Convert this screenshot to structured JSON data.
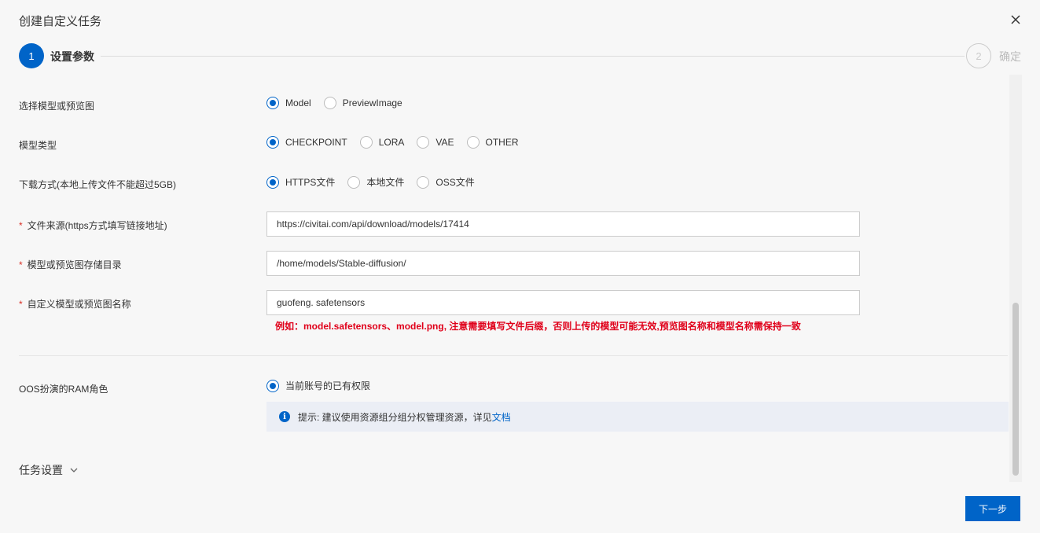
{
  "dialog": {
    "title": "创建自定义任务",
    "next_label": "下一步"
  },
  "steps": [
    {
      "number": "1",
      "label": "设置参数",
      "state": "active"
    },
    {
      "number": "2",
      "label": "确定",
      "state": "inactive"
    }
  ],
  "form": {
    "model_or_preview": {
      "label": "选择模型或预览图",
      "options": [
        "Model",
        "PreviewImage"
      ],
      "selected": "Model"
    },
    "model_type": {
      "label": "模型类型",
      "options": [
        "CHECKPOINT",
        "LORA",
        "VAE",
        "OTHER"
      ],
      "selected": "CHECKPOINT"
    },
    "download_method": {
      "label": "下载方式(本地上传文件不能超过5GB)",
      "options": [
        "HTTPS文件",
        "本地文件",
        "OSS文件"
      ],
      "selected": "HTTPS文件"
    },
    "file_source": {
      "required": "*",
      "label": "文件来源(https方式填写链接地址)",
      "value": "https://civitai.com/api/download/models/17414"
    },
    "storage_dir": {
      "required": "*",
      "label": "模型或预览图存储目录",
      "value": "/home/models/Stable-diffusion/"
    },
    "custom_name": {
      "required": "*",
      "label": "自定义模型或预览图名称",
      "value": "guofeng. safetensors",
      "hint": "例如：model.safetensors、model.png, 注意需要填写文件后缀，否则上传的模型可能无效,预览图名称和模型名称需保持一致"
    },
    "ram_role": {
      "label": "OOS扮演的RAM角色",
      "options": [
        "当前账号的已有权限"
      ],
      "selected": "当前账号的已有权限",
      "info_text": "提示: 建议使用资源组分组分权管理资源，详见",
      "info_link": "文档"
    }
  },
  "task_settings": {
    "label": "任务设置"
  },
  "colors": {
    "primary": "#0064c8",
    "required": "#d93026",
    "hint": "#e0001a",
    "background": "#f7f7f7"
  }
}
